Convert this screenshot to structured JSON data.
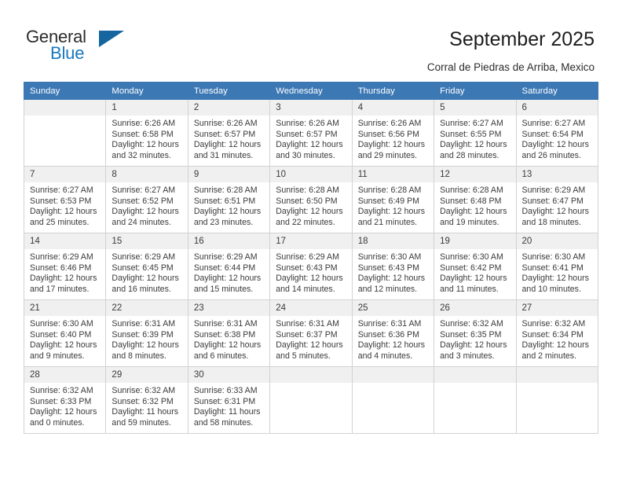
{
  "brand": {
    "line1": "General",
    "line2": "Blue",
    "triangle_icon": "triangle-icon",
    "color_dark": "#2b2b2b",
    "color_blue": "#1878be",
    "color_triangle": "#15659f"
  },
  "header": {
    "title": "September 2025",
    "subtitle": "Corral de Piedras de Arriba, Mexico"
  },
  "theme": {
    "header_row_bg": "#3c78b4",
    "daynum_bg": "#f0f0f0",
    "grid_border": "#d2d2d2",
    "text": "#3a3a3a"
  },
  "weekday_headers": [
    "Sunday",
    "Monday",
    "Tuesday",
    "Wednesday",
    "Thursday",
    "Friday",
    "Saturday"
  ],
  "labels": {
    "sunrise_prefix": "Sunrise:",
    "sunset_prefix": "Sunset:",
    "daylight_prefix": "Daylight:"
  },
  "weeks": [
    [
      {
        "day": "",
        "empty": true,
        "l1": "",
        "l2": "",
        "l3": "",
        "l4": ""
      },
      {
        "day": "1",
        "l1": "Sunrise: 6:26 AM",
        "l2": "Sunset: 6:58 PM",
        "l3": "Daylight: 12 hours",
        "l4": "and 32 minutes."
      },
      {
        "day": "2",
        "l1": "Sunrise: 6:26 AM",
        "l2": "Sunset: 6:57 PM",
        "l3": "Daylight: 12 hours",
        "l4": "and 31 minutes."
      },
      {
        "day": "3",
        "l1": "Sunrise: 6:26 AM",
        "l2": "Sunset: 6:57 PM",
        "l3": "Daylight: 12 hours",
        "l4": "and 30 minutes."
      },
      {
        "day": "4",
        "l1": "Sunrise: 6:26 AM",
        "l2": "Sunset: 6:56 PM",
        "l3": "Daylight: 12 hours",
        "l4": "and 29 minutes."
      },
      {
        "day": "5",
        "l1": "Sunrise: 6:27 AM",
        "l2": "Sunset: 6:55 PM",
        "l3": "Daylight: 12 hours",
        "l4": "and 28 minutes."
      },
      {
        "day": "6",
        "l1": "Sunrise: 6:27 AM",
        "l2": "Sunset: 6:54 PM",
        "l3": "Daylight: 12 hours",
        "l4": "and 26 minutes."
      }
    ],
    [
      {
        "day": "7",
        "l1": "Sunrise: 6:27 AM",
        "l2": "Sunset: 6:53 PM",
        "l3": "Daylight: 12 hours",
        "l4": "and 25 minutes."
      },
      {
        "day": "8",
        "l1": "Sunrise: 6:27 AM",
        "l2": "Sunset: 6:52 PM",
        "l3": "Daylight: 12 hours",
        "l4": "and 24 minutes."
      },
      {
        "day": "9",
        "l1": "Sunrise: 6:28 AM",
        "l2": "Sunset: 6:51 PM",
        "l3": "Daylight: 12 hours",
        "l4": "and 23 minutes."
      },
      {
        "day": "10",
        "l1": "Sunrise: 6:28 AM",
        "l2": "Sunset: 6:50 PM",
        "l3": "Daylight: 12 hours",
        "l4": "and 22 minutes."
      },
      {
        "day": "11",
        "l1": "Sunrise: 6:28 AM",
        "l2": "Sunset: 6:49 PM",
        "l3": "Daylight: 12 hours",
        "l4": "and 21 minutes."
      },
      {
        "day": "12",
        "l1": "Sunrise: 6:28 AM",
        "l2": "Sunset: 6:48 PM",
        "l3": "Daylight: 12 hours",
        "l4": "and 19 minutes."
      },
      {
        "day": "13",
        "l1": "Sunrise: 6:29 AM",
        "l2": "Sunset: 6:47 PM",
        "l3": "Daylight: 12 hours",
        "l4": "and 18 minutes."
      }
    ],
    [
      {
        "day": "14",
        "l1": "Sunrise: 6:29 AM",
        "l2": "Sunset: 6:46 PM",
        "l3": "Daylight: 12 hours",
        "l4": "and 17 minutes."
      },
      {
        "day": "15",
        "l1": "Sunrise: 6:29 AM",
        "l2": "Sunset: 6:45 PM",
        "l3": "Daylight: 12 hours",
        "l4": "and 16 minutes."
      },
      {
        "day": "16",
        "l1": "Sunrise: 6:29 AM",
        "l2": "Sunset: 6:44 PM",
        "l3": "Daylight: 12 hours",
        "l4": "and 15 minutes."
      },
      {
        "day": "17",
        "l1": "Sunrise: 6:29 AM",
        "l2": "Sunset: 6:43 PM",
        "l3": "Daylight: 12 hours",
        "l4": "and 14 minutes."
      },
      {
        "day": "18",
        "l1": "Sunrise: 6:30 AM",
        "l2": "Sunset: 6:43 PM",
        "l3": "Daylight: 12 hours",
        "l4": "and 12 minutes."
      },
      {
        "day": "19",
        "l1": "Sunrise: 6:30 AM",
        "l2": "Sunset: 6:42 PM",
        "l3": "Daylight: 12 hours",
        "l4": "and 11 minutes."
      },
      {
        "day": "20",
        "l1": "Sunrise: 6:30 AM",
        "l2": "Sunset: 6:41 PM",
        "l3": "Daylight: 12 hours",
        "l4": "and 10 minutes."
      }
    ],
    [
      {
        "day": "21",
        "l1": "Sunrise: 6:30 AM",
        "l2": "Sunset: 6:40 PM",
        "l3": "Daylight: 12 hours",
        "l4": "and 9 minutes."
      },
      {
        "day": "22",
        "l1": "Sunrise: 6:31 AM",
        "l2": "Sunset: 6:39 PM",
        "l3": "Daylight: 12 hours",
        "l4": "and 8 minutes."
      },
      {
        "day": "23",
        "l1": "Sunrise: 6:31 AM",
        "l2": "Sunset: 6:38 PM",
        "l3": "Daylight: 12 hours",
        "l4": "and 6 minutes."
      },
      {
        "day": "24",
        "l1": "Sunrise: 6:31 AM",
        "l2": "Sunset: 6:37 PM",
        "l3": "Daylight: 12 hours",
        "l4": "and 5 minutes."
      },
      {
        "day": "25",
        "l1": "Sunrise: 6:31 AM",
        "l2": "Sunset: 6:36 PM",
        "l3": "Daylight: 12 hours",
        "l4": "and 4 minutes."
      },
      {
        "day": "26",
        "l1": "Sunrise: 6:32 AM",
        "l2": "Sunset: 6:35 PM",
        "l3": "Daylight: 12 hours",
        "l4": "and 3 minutes."
      },
      {
        "day": "27",
        "l1": "Sunrise: 6:32 AM",
        "l2": "Sunset: 6:34 PM",
        "l3": "Daylight: 12 hours",
        "l4": "and 2 minutes."
      }
    ],
    [
      {
        "day": "28",
        "l1": "Sunrise: 6:32 AM",
        "l2": "Sunset: 6:33 PM",
        "l3": "Daylight: 12 hours",
        "l4": "and 0 minutes."
      },
      {
        "day": "29",
        "l1": "Sunrise: 6:32 AM",
        "l2": "Sunset: 6:32 PM",
        "l3": "Daylight: 11 hours",
        "l4": "and 59 minutes."
      },
      {
        "day": "30",
        "l1": "Sunrise: 6:33 AM",
        "l2": "Sunset: 6:31 PM",
        "l3": "Daylight: 11 hours",
        "l4": "and 58 minutes."
      },
      {
        "day": "",
        "empty": true,
        "l1": "",
        "l2": "",
        "l3": "",
        "l4": ""
      },
      {
        "day": "",
        "empty": true,
        "l1": "",
        "l2": "",
        "l3": "",
        "l4": ""
      },
      {
        "day": "",
        "empty": true,
        "l1": "",
        "l2": "",
        "l3": "",
        "l4": ""
      },
      {
        "day": "",
        "empty": true,
        "l1": "",
        "l2": "",
        "l3": "",
        "l4": ""
      }
    ]
  ]
}
